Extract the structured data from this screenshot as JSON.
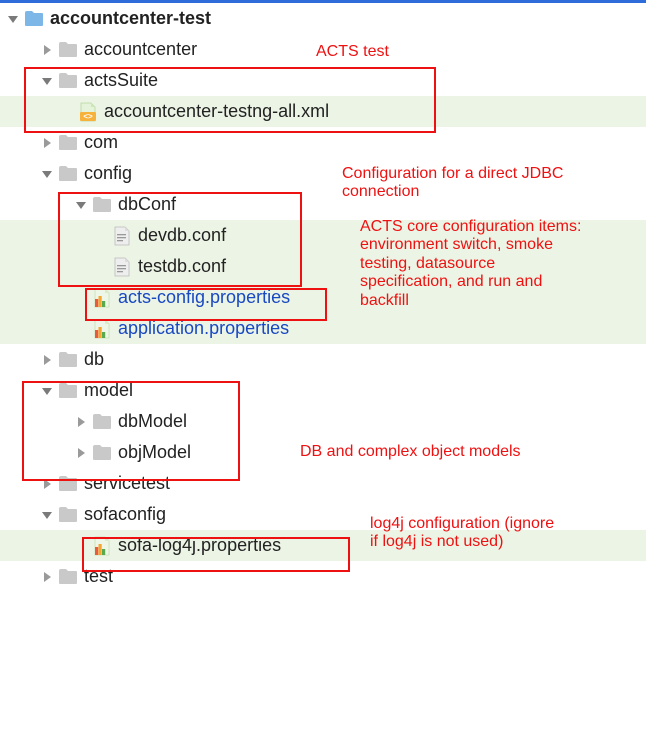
{
  "tree": {
    "root": "accountcenter-test",
    "nodes": {
      "accountcenter": "accountcenter",
      "actsSuite": "actsSuite",
      "xml": "accountcenter-testng-all.xml",
      "com": "com",
      "config": "config",
      "dbConf": "dbConf",
      "devdb": "devdb.conf",
      "testdb": "testdb.conf",
      "actsConfig": "acts-config.properties",
      "appProps": "application.properties",
      "db": "db",
      "model": "model",
      "dbModel": "dbModel",
      "objModel": "objModel",
      "servicetest": "servicetest",
      "sofaconfig": "sofaconfig",
      "sofalog": "sofa-log4j.properties",
      "test": "test"
    }
  },
  "annotations": {
    "actsTest": "ACTS test",
    "jdbc": "Configuration for a direct JDBC connection",
    "core": "ACTS core configuration items: environment switch, smoke testing, datasource specification, and run and backfill",
    "models": "DB and complex object models",
    "log4j": "log4j configuration (ignore if log4j is not used)"
  }
}
